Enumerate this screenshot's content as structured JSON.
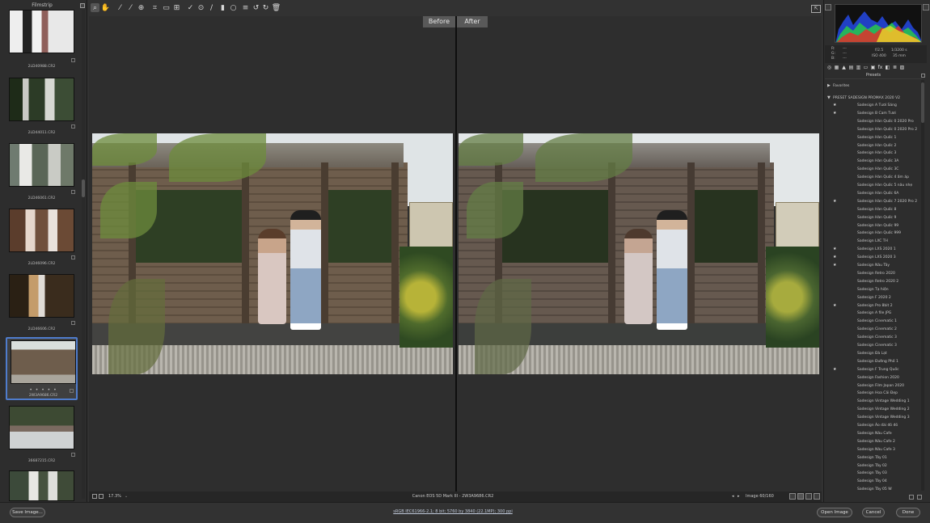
{
  "filmstrip": {
    "title": "Filmstrip",
    "items": [
      {
        "name": "2LD40988.CR2"
      },
      {
        "name": "2LD44011.CR2"
      },
      {
        "name": "2LD46061.CR2"
      },
      {
        "name": "2LD46096.CR2"
      },
      {
        "name": "2LD46606.CR2"
      },
      {
        "name": "2W3A9686.CR2",
        "dots": "• • • • •"
      },
      {
        "name": "36687215.CR2"
      }
    ]
  },
  "toolbar": {
    "tools": [
      "zoom-icon",
      "hand-icon",
      "white-balance-icon",
      "color-sampler-icon",
      "target-adjust-icon",
      "crop-icon",
      "straighten-icon",
      "transform-icon",
      "spot-removal-icon",
      "red-eye-icon",
      "brush-icon",
      "graduated-filter-icon",
      "radial-filter-icon",
      "presets-list-icon",
      "rotate-ccw-icon",
      "rotate-cw-icon",
      "trash-icon"
    ]
  },
  "compare": {
    "before_label": "Before",
    "after_label": "After"
  },
  "bottombar": {
    "zoom": "17.3%",
    "camera": "Canon EOS 5D Mark III  -  2W3A9686.CR2",
    "image_counter": "Image 60/160"
  },
  "camera_info": {
    "r": "R:",
    "g": "G:",
    "b": "B:",
    "r_val": "---",
    "g_val": "---",
    "b_val": "---",
    "aperture": "f/2.5",
    "shutter": "1/3200 s",
    "iso": "ISO 400",
    "focal": "35 mm"
  },
  "presets": {
    "title": "Presets",
    "favorites": "Favorites",
    "group": "PRESET SADESIGN PROMAX 2020 V2",
    "items": [
      {
        "label": "Sadesign A Tươi Sáng",
        "star": true
      },
      {
        "label": "Sadesign B Cam Tươi",
        "star": true
      },
      {
        "label": "Sadesign Hàn Quốc 0 2020 Pro",
        "star": false
      },
      {
        "label": "Sadesign Hàn Quốc 0 2020 Pro 2",
        "star": false
      },
      {
        "label": "Sadesign Hàn Quốc 1",
        "star": false
      },
      {
        "label": "Sadesign Hàn Quốc 2",
        "star": false
      },
      {
        "label": "Sadesign Hàn Quốc 3",
        "star": false
      },
      {
        "label": "Sadesign Hàn Quốc 3A",
        "star": false
      },
      {
        "label": "Sadesign Hàn Quốc 3C",
        "star": false
      },
      {
        "label": "Sadesign Hàn Quốc 4 ấm áp",
        "star": false
      },
      {
        "label": "Sadesign Hàn Quốc 5 nâu nhẹ",
        "star": false
      },
      {
        "label": "Sadesign Hàn Quốc 6A",
        "star": false
      },
      {
        "label": "Sadesign Hàn Quốc 7 2020 Pro 2",
        "star": true
      },
      {
        "label": "Sadesign Hàn Quốc 8",
        "star": false
      },
      {
        "label": "Sadesign Hàn Quốc 9",
        "star": false
      },
      {
        "label": "Sadesign Hàn Quốc 99",
        "star": false
      },
      {
        "label": "Sadesign Hàn Quốc 999",
        "star": false
      },
      {
        "label": "Sadesign LXC TH",
        "star": false
      },
      {
        "label": "Sadesign LXS 2020 1",
        "star": true
      },
      {
        "label": "Sadesign LXS 2020 3",
        "star": true
      },
      {
        "label": "Sadesign Nâu Tây",
        "star": true
      },
      {
        "label": "Sadesign Retro 2020",
        "star": false
      },
      {
        "label": "Sadesign Retro 2020 2",
        "star": false
      },
      {
        "label": "Sadesign Tạ hiện",
        "star": false
      },
      {
        "label": "Sadesign F 2020 2",
        "star": false
      },
      {
        "label": "Sadesign Pro 8bit 2",
        "star": true
      },
      {
        "label": "Sadesign A file JPG",
        "star": false
      },
      {
        "label": "Sadesign Cinematic 1",
        "star": false
      },
      {
        "label": "Sadesign Cinematic 2",
        "star": false
      },
      {
        "label": "Sadesign Cinematic 3",
        "star": false
      },
      {
        "label": "Sadesign Cinematic 3",
        "star": false
      },
      {
        "label": "Sadesign Đà Lạt",
        "star": false
      },
      {
        "label": "Sadesign Đường Phố 1",
        "star": false
      },
      {
        "label": "Sadesign F Trung Quốc",
        "star": true
      },
      {
        "label": "Sadesign Fashion 2020",
        "star": false
      },
      {
        "label": "Sadesign Film Japan 2020",
        "star": false
      },
      {
        "label": "Sadesign Hoa Cải Đẹp",
        "star": false
      },
      {
        "label": "Sadesign Vintage Wedding 1",
        "star": false
      },
      {
        "label": "Sadesign Vintage Wedding 2",
        "star": false
      },
      {
        "label": "Sadesign Vintage Wedding 3",
        "star": false
      },
      {
        "label": "Sadesign Áo dài đỏ đỏ",
        "star": false
      },
      {
        "label": "Sadesign Nâu Cafe",
        "star": false
      },
      {
        "label": "Sadesign Nâu Cafe 2",
        "star": false
      },
      {
        "label": "Sadesign Nâu Cafe 3",
        "star": false
      },
      {
        "label": "Sadesign Tây 01",
        "star": false
      },
      {
        "label": "Sadesign Tây 02",
        "star": false
      },
      {
        "label": "Sadesign Tây 03",
        "star": false
      },
      {
        "label": "Sadesign Tây 04",
        "star": false
      },
      {
        "label": "Sadesign Tây 05 W",
        "star": false
      }
    ]
  },
  "footer": {
    "save_label": "Save Image...",
    "file_info": "sRGB IEC61966-2.1; 8 bit; 5760 by 3840 (22.1MP); 300 ppi",
    "open_label": "Open Image",
    "cancel_label": "Cancel",
    "done_label": "Done"
  },
  "colors": {
    "selection": "#4f7ccc",
    "background": "#323232",
    "panel": "#2d2d2d"
  }
}
